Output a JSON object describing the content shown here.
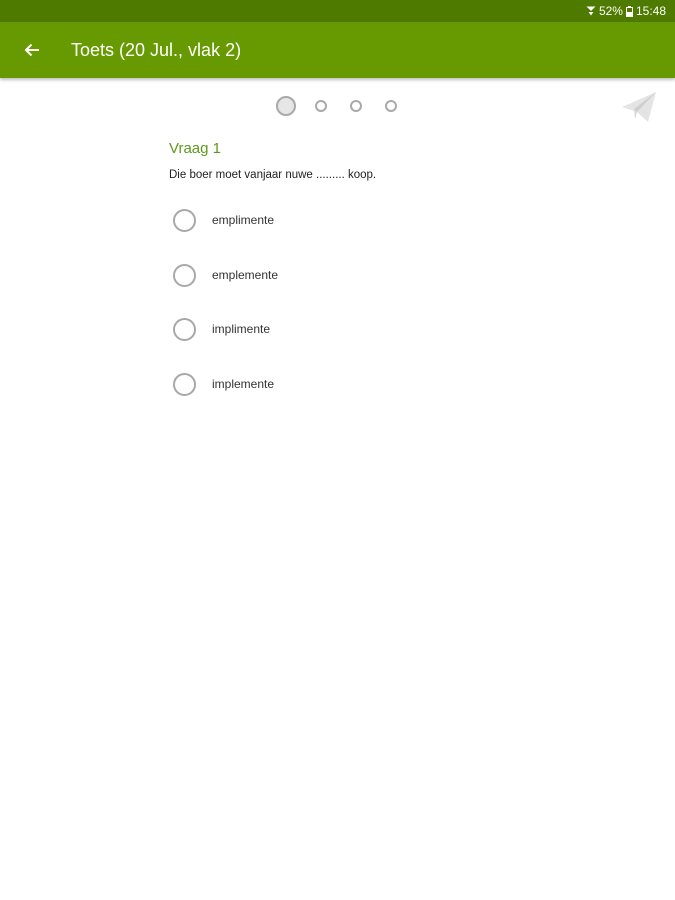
{
  "status_bar": {
    "battery": "52%",
    "time": "15:48",
    "signal_icon": "network-icon",
    "battery_icon": "battery-icon"
  },
  "app_bar": {
    "title": "Toets (20 Jul., vlak 2)",
    "back_icon": "arrow-left-icon",
    "color": "#669a00",
    "status_color": "#4f7a00"
  },
  "pager": {
    "count": 4,
    "active_index": 0
  },
  "send_icon": "send-icon",
  "question": {
    "title": "Vraag 1",
    "text": "Die boer moet vanjaar nuwe ......... koop.",
    "title_color": "#5c9a1e",
    "options": [
      {
        "label": "emplimente",
        "selected": false
      },
      {
        "label": "emplemente",
        "selected": false
      },
      {
        "label": "implimente",
        "selected": false
      },
      {
        "label": "implemente",
        "selected": false
      }
    ]
  }
}
